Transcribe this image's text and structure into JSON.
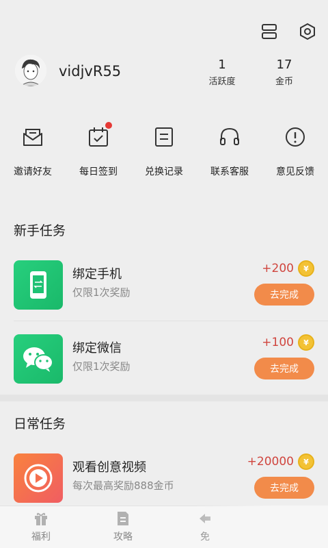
{
  "profile": {
    "username": "vidjvR55",
    "stats": [
      {
        "value": "1",
        "label": "活跃度"
      },
      {
        "value": "17",
        "label": "金币"
      }
    ]
  },
  "quick_actions": [
    {
      "label": "邀请好友",
      "icon": "envelope-icon"
    },
    {
      "label": "每日签到",
      "icon": "calendar-check-icon",
      "badge": true
    },
    {
      "label": "兑换记录",
      "icon": "document-list-icon"
    },
    {
      "label": "联系客服",
      "icon": "headphones-icon"
    },
    {
      "label": "意见反馈",
      "icon": "exclamation-circle-icon"
    }
  ],
  "sections": {
    "newbie_title": "新手任务",
    "daily_title": "日常任务"
  },
  "tasks": [
    {
      "title": "绑定手机",
      "desc": "仅限1次奖励",
      "reward": "+200",
      "button": "去完成",
      "icon": "phone-icon",
      "color": "#1fc274"
    },
    {
      "title": "绑定微信",
      "desc": "仅限1次奖励",
      "reward": "+100",
      "button": "去完成",
      "icon": "wechat-icon",
      "color": "#1fc274"
    },
    {
      "title": "观看创意视频",
      "desc": "每次最高奖励888金币",
      "reward": "+20000",
      "button": "去完成",
      "icon": "play-icon",
      "color": "#f5704f"
    }
  ],
  "coin_symbol": "¥",
  "bottom_nav": [
    {
      "label": "福利",
      "icon": "gift-icon"
    },
    {
      "label": "攻略",
      "icon": "doc-icon"
    },
    {
      "label": "免",
      "icon": "arrow-icon"
    }
  ],
  "colors": {
    "accent_button": "#f28b4a",
    "reward_text": "#d0453e",
    "green_task": "#1fc274",
    "red_badge": "#e53935"
  }
}
